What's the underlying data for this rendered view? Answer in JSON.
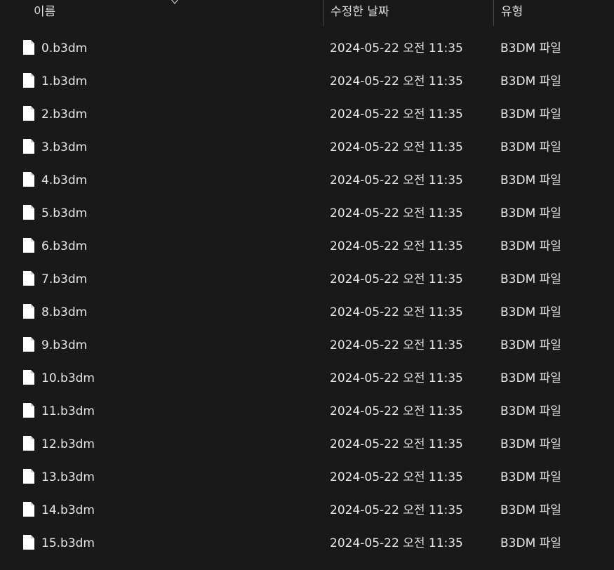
{
  "columns": {
    "name": "이름",
    "date_modified": "수정한 날짜",
    "type": "유형"
  },
  "files": [
    {
      "name": "0.b3dm",
      "date": "2024-05-22 오전 11:35",
      "type": "B3DM 파일"
    },
    {
      "name": "1.b3dm",
      "date": "2024-05-22 오전 11:35",
      "type": "B3DM 파일"
    },
    {
      "name": "2.b3dm",
      "date": "2024-05-22 오전 11:35",
      "type": "B3DM 파일"
    },
    {
      "name": "3.b3dm",
      "date": "2024-05-22 오전 11:35",
      "type": "B3DM 파일"
    },
    {
      "name": "4.b3dm",
      "date": "2024-05-22 오전 11:35",
      "type": "B3DM 파일"
    },
    {
      "name": "5.b3dm",
      "date": "2024-05-22 오전 11:35",
      "type": "B3DM 파일"
    },
    {
      "name": "6.b3dm",
      "date": "2024-05-22 오전 11:35",
      "type": "B3DM 파일"
    },
    {
      "name": "7.b3dm",
      "date": "2024-05-22 오전 11:35",
      "type": "B3DM 파일"
    },
    {
      "name": "8.b3dm",
      "date": "2024-05-22 오전 11:35",
      "type": "B3DM 파일"
    },
    {
      "name": "9.b3dm",
      "date": "2024-05-22 오전 11:35",
      "type": "B3DM 파일"
    },
    {
      "name": "10.b3dm",
      "date": "2024-05-22 오전 11:35",
      "type": "B3DM 파일"
    },
    {
      "name": "11.b3dm",
      "date": "2024-05-22 오전 11:35",
      "type": "B3DM 파일"
    },
    {
      "name": "12.b3dm",
      "date": "2024-05-22 오전 11:35",
      "type": "B3DM 파일"
    },
    {
      "name": "13.b3dm",
      "date": "2024-05-22 오전 11:35",
      "type": "B3DM 파일"
    },
    {
      "name": "14.b3dm",
      "date": "2024-05-22 오전 11:35",
      "type": "B3DM 파일"
    },
    {
      "name": "15.b3dm",
      "date": "2024-05-22 오전 11:35",
      "type": "B3DM 파일"
    }
  ],
  "icons": {
    "file": "file-icon",
    "sort": "sort-ascending-icon"
  },
  "colors": {
    "background": "#191919",
    "text": "#e6e6e6",
    "divider": "#4a4a4a",
    "icon": "#ffffff"
  }
}
